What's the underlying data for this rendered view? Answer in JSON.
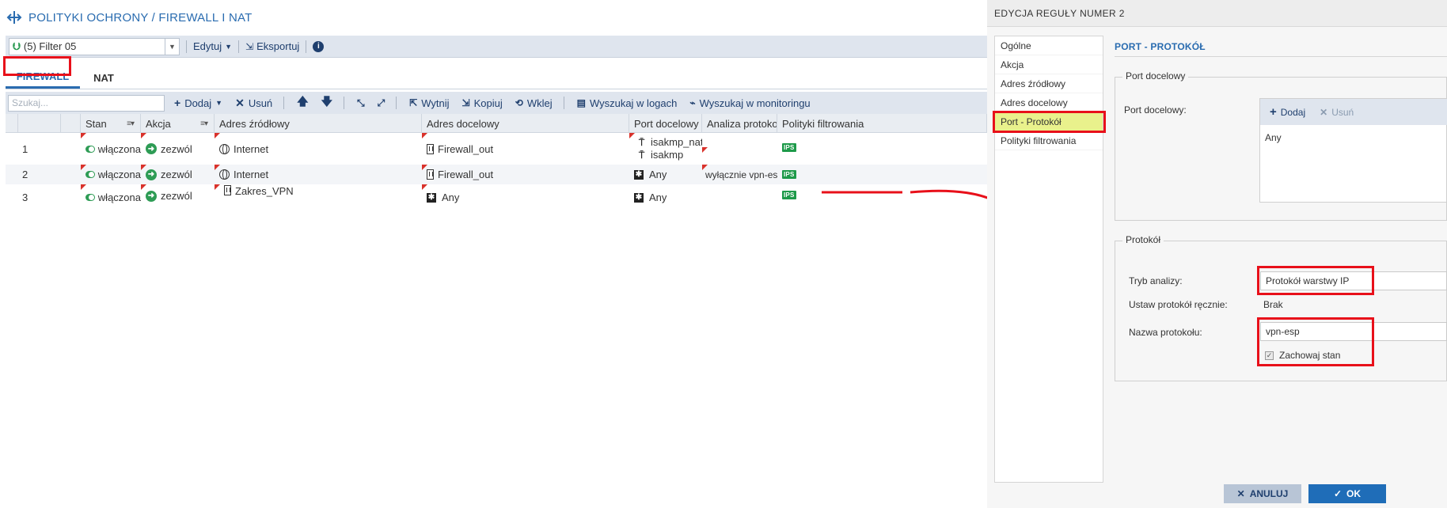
{
  "header": {
    "title": "POLITYKI OCHRONY / FIREWALL I NAT"
  },
  "toolbar": {
    "filter_value": "(5) Filter 05",
    "edit_label": "Edytuj",
    "export_label": "Eksportuj"
  },
  "tabs": [
    {
      "label": "FIREWALL",
      "active": true
    },
    {
      "label": "NAT",
      "active": false
    }
  ],
  "rule_toolbar": {
    "search_placeholder": "Szukaj...",
    "add_label": "Dodaj",
    "remove_label": "Usuń",
    "cut_label": "Wytnij",
    "copy_label": "Kopiuj",
    "paste_label": "Wklej",
    "search_logs_label": "Wyszukaj w logach",
    "search_monitoring_label": "Wyszukaj w monitoringu"
  },
  "grid": {
    "columns": [
      "Stan",
      "Akcja",
      "Adres źródłowy",
      "Adres docelowy",
      "Port docelowy",
      "Analiza protokoł...",
      "Polityki filtrowania"
    ],
    "rows": [
      {
        "num": "1",
        "state": "włączona",
        "action": "zezwól",
        "source": "Internet",
        "dest": "Firewall_out",
        "ports": [
          "isakmp_natt",
          "isakmp"
        ],
        "analysis": "",
        "filter": "IPS"
      },
      {
        "num": "2",
        "state": "włączona",
        "action": "zezwól",
        "source": "Internet",
        "dest": "Firewall_out",
        "ports": [
          "Any"
        ],
        "analysis": "wyłącznie vpn-esp",
        "filter": "IPS"
      },
      {
        "num": "3",
        "state": "włączona",
        "action": "zezwól",
        "source": "Zakres_VPN",
        "dest": "Any",
        "ports": [
          "Any"
        ],
        "analysis": "",
        "filter": "IPS"
      }
    ]
  },
  "editor": {
    "title": "EDYCJA REGUŁY NUMER 2",
    "nav": [
      "Ogólne",
      "Akcja",
      "Adres źródłowy",
      "Adres docelowy",
      "Port - Protokół",
      "Polityki filtrowania"
    ],
    "section_title": "PORT - PROTOKÓŁ",
    "port_fieldset": "Port docelowy",
    "port_label": "Port docelowy:",
    "port_add": "Dodaj",
    "port_remove": "Usuń",
    "port_values": [
      "Any"
    ],
    "protocol_fieldset": "Protokół",
    "analysis_mode_label": "Tryb analizy:",
    "analysis_mode_value": "Protokół warstwy IP",
    "manual_protocol_label": "Ustaw protokół ręcznie:",
    "manual_protocol_value": "Brak",
    "protocol_name_label": "Nazwa protokołu:",
    "protocol_name_value": "vpn-esp",
    "keep_state_label": "Zachowaj stan",
    "cancel_label": "ANULUJ",
    "ok_label": "OK"
  },
  "colors": {
    "accent": "#2a6cb0",
    "highlight_box": "#e8101a",
    "nav_selected": "#e9f18c",
    "ok_button": "#1f6db8",
    "allow_green": "#2e9c55"
  }
}
